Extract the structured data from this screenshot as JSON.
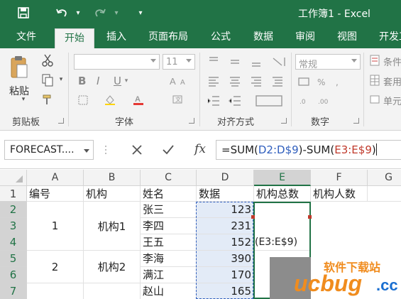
{
  "title_bar": {
    "title": "工作簿1 - Excel"
  },
  "tabs": [
    {
      "label": "文件"
    },
    {
      "label": "开始"
    },
    {
      "label": "插入"
    },
    {
      "label": "页面布局"
    },
    {
      "label": "公式"
    },
    {
      "label": "数据"
    },
    {
      "label": "审阅"
    },
    {
      "label": "视图"
    },
    {
      "label": "开发工"
    }
  ],
  "ribbon": {
    "clipboard": {
      "paste_label": "粘贴",
      "group_label": "剪贴板"
    },
    "font": {
      "size_value": "11",
      "group_label": "字体",
      "bold": "B",
      "italic": "I",
      "underline": "U"
    },
    "alignment": {
      "group_label": "对齐方式"
    },
    "number": {
      "format_value": "常规",
      "group_label": "数字"
    },
    "styles": {
      "cond_format": "条件",
      "table_format": "套用",
      "cell_style": "单元"
    }
  },
  "formula_bar": {
    "name_box": "FORECAST....",
    "fx": "fx",
    "formula_parts": [
      "=SUM(",
      "D2:D$9",
      ")-SUM(",
      "E3:E$9",
      ")"
    ]
  },
  "grid": {
    "columns": [
      "A",
      "B",
      "C",
      "D",
      "E",
      "F",
      "G"
    ],
    "rows": [
      "1",
      "2",
      "3",
      "4",
      "5",
      "6",
      "7"
    ],
    "header_row": [
      "编号",
      "机构",
      "姓名",
      "数据",
      "机构总数",
      "机构人数"
    ],
    "merged_a": [
      "1",
      "2"
    ],
    "merged_b": [
      "机构1",
      "机构2"
    ],
    "names": [
      "张三",
      "李四",
      "王五",
      "李海",
      "满江",
      "赵山"
    ],
    "values": [
      "123",
      "231",
      "152",
      "390",
      "170",
      "165"
    ],
    "e_overflow": "(E3:E$9)"
  },
  "watermark": {
    "text": "软件下载站",
    "logo": "ucbug",
    "suffix": ".cc"
  },
  "colors": {
    "accent": "#217346",
    "ref_blue": "#2f5ebd",
    "ref_red": "#c0392b",
    "watermark_orange": "#f08c1e",
    "watermark_blue": "#1a6fd1"
  }
}
